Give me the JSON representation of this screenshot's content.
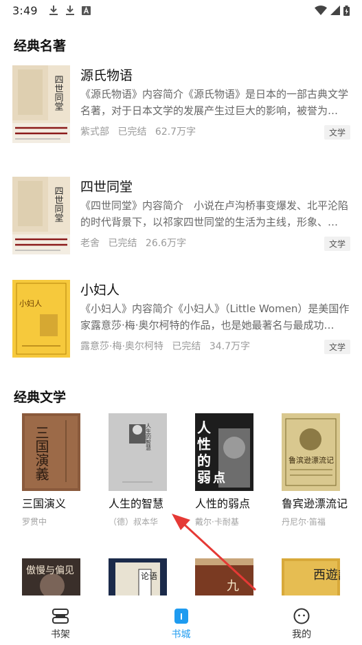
{
  "status_bar": {
    "time": "3:49",
    "left_icons": [
      "download-icon",
      "download-icon",
      "app-a-icon"
    ],
    "right_icons": [
      "wifi-icon",
      "signal-icon",
      "battery-icon"
    ]
  },
  "sections": {
    "classic_masterpieces": {
      "title": "经典名著"
    },
    "classic_literature": {
      "title": "经典文学"
    }
  },
  "book_list": [
    {
      "title": "源氏物语",
      "description": "《源氏物语》内容简介《源氏物语》是日本的一部古典文学名著，对于日本文学的发展产生过巨大的影响，被誉为…",
      "author": "紫式部",
      "status": "已完结",
      "word_count": "62.7万字",
      "tag": "文学",
      "cover_text": "四世同堂"
    },
    {
      "title": "四世同堂",
      "description": "《四世同堂》内容简介　小说在卢沟桥事变爆发、北平沦陷的时代背景下，以祁家四世同堂的生活为主线，形象、…",
      "author": "老舍",
      "status": "已完结",
      "word_count": "26.6万字",
      "tag": "文学",
      "cover_text": "四世同堂"
    },
    {
      "title": "小妇人",
      "description": "《小妇人》内容简介《小妇人》（Little Women）是美国作家露意莎·梅·奥尔柯特的作品，也是她最著名与最成功…",
      "author": "露意莎·梅·奥尔柯特",
      "status": "已完结",
      "word_count": "34.7万字",
      "tag": "文学",
      "cover_text": "小妇人"
    }
  ],
  "book_grid": [
    {
      "title": "三国演义",
      "author": "罗贯中",
      "cover_text": "三国演義"
    },
    {
      "title": "人生的智慧",
      "author": "（德）叔本华",
      "cover_text": "人生的智慧"
    },
    {
      "title": "人性的弱点",
      "author": "戴尔·卡耐基",
      "cover_text": "人性的弱点"
    },
    {
      "title": "鲁宾逊漂流记",
      "author": "丹尼尔·笛福",
      "cover_text": "鲁滨逊漂流记"
    },
    {
      "title": "",
      "author": "",
      "cover_text": "傲慢与偏见"
    },
    {
      "title": "",
      "author": "",
      "cover_text": "论语"
    },
    {
      "title": "",
      "author": "",
      "cover_text": "九"
    },
    {
      "title": "",
      "author": "",
      "cover_text": "西遊記"
    }
  ],
  "bottom_nav": {
    "tabs": [
      {
        "label": "书架",
        "icon": "bookshelf-icon",
        "active": false
      },
      {
        "label": "书城",
        "icon": "bookstore-icon",
        "active": true
      },
      {
        "label": "我的",
        "icon": "profile-icon",
        "active": false
      }
    ]
  },
  "colors": {
    "accent": "#1e9bf0",
    "annotation_arrow": "#e53935"
  }
}
